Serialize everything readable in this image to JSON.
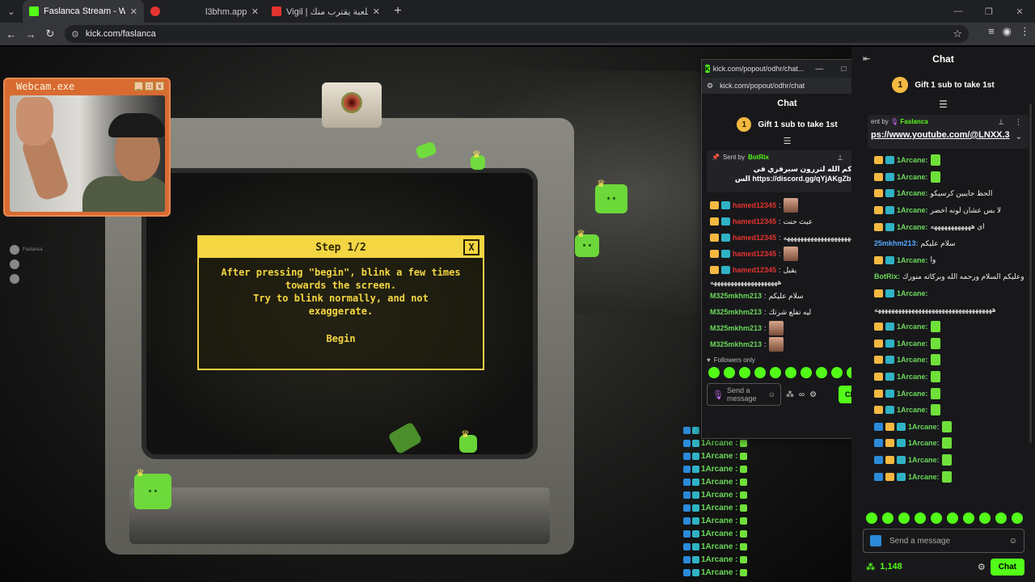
{
  "browser": {
    "tabs": [
      {
        "title": "Faslanca Stream - Watch Live o",
        "favicon_color": "#53fc18",
        "active": true
      },
      {
        "title": "l3bhm.app | لعبهم",
        "favicon_color": "#e3342f",
        "active": false
      },
      {
        "title": "Vigil | اللي في اللعبة يقترب منك",
        "favicon_color": "#e3342f",
        "active": false
      }
    ],
    "url": "kick.com/faslanca"
  },
  "webcam": {
    "title": "Webcam.exe",
    "buttons": [
      "_",
      "□",
      "x"
    ]
  },
  "dialog": {
    "title": "Step 1/2",
    "close": "X",
    "line1": "After pressing \"begin\", blink a few times",
    "line2": "towards the screen.",
    "line3": "Try to blink normally, and not",
    "line4": "exaggerate.",
    "begin": "Begin"
  },
  "overlay_users": [
    "Faslanca"
  ],
  "overlay_chat": [
    "1Arcane :",
    "1Arcane :",
    "1Arcane :",
    "1Arcane :",
    "1Arcane :",
    "1Arcane :",
    "1Arcane :",
    "1Arcane :",
    "1Arcane :",
    "1Arcane :",
    "1Arcane :",
    "1Arcane :",
    "1Arcane :"
  ],
  "popout": {
    "window_title": "kick.com/popout/odhr/chat...",
    "url": "kick.com/popout/odhr/chat",
    "header": "Chat",
    "gift_number": "1",
    "gift_text": "Gift 1 sub to take 1st",
    "pinned_sent_by": "Sent by",
    "pinned_user": "BotRix",
    "pinned_msg_line1": "حياكم الله لتررون سيرفري في",
    "pinned_msg_line2": "https://discord.gg/qYjAKgZbUm الس",
    "messages": [
      {
        "name": "hamed12345",
        "color": "#e3342f",
        "text": "",
        "emote": true,
        "badges": true
      },
      {
        "name": "hamed12345",
        "color": "#e3342f",
        "text": "عيث حنت",
        "emote": false,
        "badges": true
      },
      {
        "name": "hamed12345",
        "color": "#e3342f",
        "text": "ههههههههههههههههههههه",
        "emote": false,
        "badges": true
      },
      {
        "name": "hamed12345",
        "color": "#e3342f",
        "text": "",
        "emote": true,
        "badges": true
      },
      {
        "name": "hamed12345",
        "color": "#e3342f",
        "text": "يقيل",
        "emote": false,
        "badges": true
      },
      {
        "name": "",
        "color": "#eee",
        "text": "ههههههههههههههههههههه",
        "emote": false,
        "badges": false
      },
      {
        "name": "M325mkhm213",
        "color": "#6bd85a",
        "text": "سلام عليكم",
        "emote": false,
        "badges": false
      },
      {
        "name": "M325mkhm213",
        "color": "#6bd85a",
        "text": "ليه تفلع شرتك",
        "emote": false,
        "badges": false
      },
      {
        "name": "M325mkhm213",
        "color": "#6bd85a",
        "text": "",
        "emote": true,
        "badges": false
      },
      {
        "name": "M325mkhm213",
        "color": "#6bd85a",
        "text": "",
        "emote": true,
        "badges": false
      }
    ],
    "followers_only": "Followers only",
    "input_placeholder": "Send a message",
    "chat_button": "Chat"
  },
  "side": {
    "header": "Chat",
    "gift_number": "1",
    "gift_text": "Gift 1 sub to take 1st",
    "pinned_sent_by": "ent by",
    "pinned_user": "Faslanca",
    "pinned_link": "ps://www.youtube.com/@LNXX.3",
    "messages": [
      {
        "name": "1Arcane:",
        "text": "",
        "gem": true,
        "blue": false
      },
      {
        "name": "1Arcane:",
        "text": "",
        "gem": true,
        "blue": false
      },
      {
        "name": "1Arcane:",
        "text": "الحظ جايبين كرسيكو",
        "gem": false,
        "blue": false
      },
      {
        "name": "1Arcane:",
        "text": "لا بس عشان لونه اخضر",
        "gem": false,
        "blue": false
      },
      {
        "name": "1Arcane:",
        "text": "اي ههههههههههههه",
        "gem": false,
        "blue": false
      },
      {
        "name": "25mkhm213:",
        "text": "سلام عليكم",
        "gem": false,
        "blue": false,
        "color": "#53a8ff"
      },
      {
        "name": "1Arcane:",
        "text": "وا",
        "gem": false,
        "blue": false
      },
      {
        "name": "BotRix:",
        "text": "وعليكم السلام ورحمه الله وبركاته منورك",
        "gem": false,
        "blue": false
      },
      {
        "name": "1Arcane:",
        "text": "",
        "gem": false,
        "blue": false
      },
      {
        "name": "",
        "text": "هههههههههههههههههههههههههههههههههههه",
        "gem": false,
        "blue": false,
        "nobadge": true
      },
      {
        "name": "1Arcane:",
        "text": "",
        "gem": true,
        "blue": false
      },
      {
        "name": "1Arcane:",
        "text": "",
        "gem": true,
        "blue": false
      },
      {
        "name": "1Arcane:",
        "text": "",
        "gem": true,
        "blue": false
      },
      {
        "name": "1Arcane:",
        "text": "",
        "gem": true,
        "blue": false
      },
      {
        "name": "1Arcane:",
        "text": "",
        "gem": true,
        "blue": false
      },
      {
        "name": "1Arcane:",
        "text": "",
        "gem": true,
        "blue": false
      },
      {
        "name": "1Arcane:",
        "text": "",
        "gem": true,
        "blue": true
      },
      {
        "name": "1Arcane:",
        "text": "",
        "gem": true,
        "blue": true
      },
      {
        "name": "1Arcane:",
        "text": "",
        "gem": true,
        "blue": true
      },
      {
        "name": "1Arcane:",
        "text": "",
        "gem": true,
        "blue": true
      }
    ],
    "input_placeholder": "Send a message",
    "points": "1,148",
    "chat_button": "Chat"
  },
  "colors": {
    "kick_green": "#53fc18",
    "dialog_yellow": "#f4d643",
    "webcam_orange": "#d86b32"
  }
}
